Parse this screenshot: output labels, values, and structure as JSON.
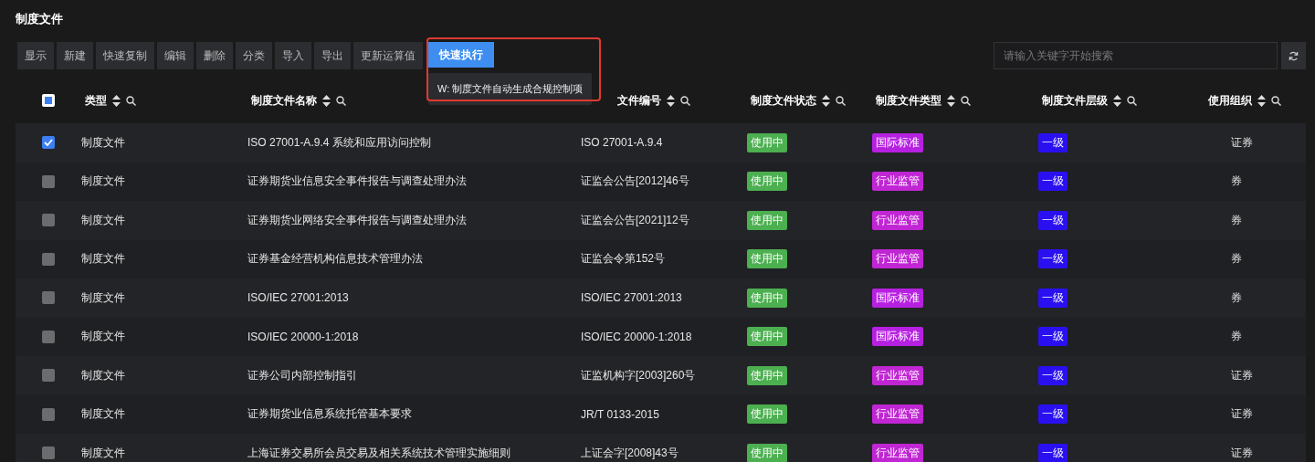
{
  "title": "制度文件",
  "toolbar": [
    {
      "label": "显示",
      "kind": "plain"
    },
    {
      "label": "新建",
      "kind": "plain"
    },
    {
      "label": "快速复制",
      "kind": "plain"
    },
    {
      "label": "编辑",
      "kind": "plain"
    },
    {
      "label": "删除",
      "kind": "plain"
    },
    {
      "label": "分类",
      "kind": "plain"
    },
    {
      "label": "导入",
      "kind": "plain"
    },
    {
      "label": "导出",
      "kind": "plain"
    },
    {
      "label": "更新运算值",
      "kind": "plain"
    },
    {
      "label": "快速执行",
      "kind": "menu",
      "expanded": true,
      "highlighted": true,
      "menu_items": [
        "W: 制度文件自动生成合规控制项"
      ]
    }
  ],
  "search": {
    "placeholder": "请输入关键字开始搜索"
  },
  "table": {
    "select_all": {
      "indeterminate": true
    },
    "columns": [
      {
        "label": "类型"
      },
      {
        "label": "制度文件名称"
      },
      {
        "label": "文件编号"
      },
      {
        "label": "制度文件状态"
      },
      {
        "label": "制度文件类型"
      },
      {
        "label": "制度文件层级"
      },
      {
        "label": "使用组织"
      }
    ],
    "rows": [
      {
        "checked": true,
        "type": "制度文件",
        "name": "ISO 27001-A.9.4 系统和应用访问控制",
        "number": "ISO 27001-A.9.4",
        "status": "使用中",
        "doc_type": {
          "text": "国际标准",
          "color": "#b620e0"
        },
        "level": "一级",
        "org": "证券"
      },
      {
        "checked": false,
        "type": "制度文件",
        "name": "证券期货业信息安全事件报告与调查处理办法",
        "number": "证监会公告[2012]46号",
        "status": "使用中",
        "doc_type": {
          "text": "行业监管",
          "color": "#c026d3"
        },
        "level": "一级",
        "org": "券"
      },
      {
        "checked": false,
        "type": "制度文件",
        "name": "证券期货业网络安全事件报告与调查处理办法",
        "number": "证监会公告[2021]12号",
        "status": "使用中",
        "doc_type": {
          "text": "行业监管",
          "color": "#c026d3"
        },
        "level": "一级",
        "org": "券"
      },
      {
        "checked": false,
        "type": "制度文件",
        "name": "证券基金经营机构信息技术管理办法",
        "number": "证监会令第152号",
        "status": "使用中",
        "doc_type": {
          "text": "行业监管",
          "color": "#c026d3"
        },
        "level": "一级",
        "org": "券"
      },
      {
        "checked": false,
        "type": "制度文件",
        "name": "ISO/IEC 27001:2013",
        "number": "ISO/IEC 27001:2013",
        "status": "使用中",
        "doc_type": {
          "text": "国际标准",
          "color": "#b620e0"
        },
        "level": "一级",
        "org": "券"
      },
      {
        "checked": false,
        "type": "制度文件",
        "name": "ISO/IEC 20000-1:2018",
        "number": "ISO/IEC 20000-1:2018",
        "status": "使用中",
        "doc_type": {
          "text": "国际标准",
          "color": "#b620e0"
        },
        "level": "一级",
        "org": "券"
      },
      {
        "checked": false,
        "type": "制度文件",
        "name": "证券公司内部控制指引",
        "number": "证监机构字[2003]260号",
        "status": "使用中",
        "doc_type": {
          "text": "行业监管",
          "color": "#c026d3"
        },
        "level": "一级",
        "org": "证券"
      },
      {
        "checked": false,
        "type": "制度文件",
        "name": "证券期货业信息系统托管基本要求",
        "number": "JR/T 0133-2015",
        "status": "使用中",
        "doc_type": {
          "text": "行业监管",
          "color": "#c026d3"
        },
        "level": "一级",
        "org": "证券"
      },
      {
        "checked": false,
        "type": "制度文件",
        "name": "上海证券交易所会员交易及相关系统技术管理实施细则",
        "number": "上证会字[2008]43号",
        "status": "使用中",
        "doc_type": {
          "text": "行业监管",
          "color": "#c026d3"
        },
        "level": "一级",
        "org": "证券"
      }
    ]
  }
}
